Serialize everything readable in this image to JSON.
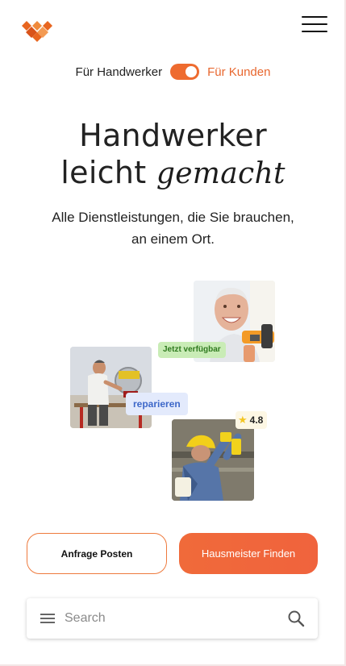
{
  "toggle": {
    "left_label": "Für Handwerker",
    "right_label": "Für Kunden",
    "active": "right"
  },
  "hero": {
    "title_line1": "Handwerker",
    "title_line2_plain": "leicht",
    "title_line2_script": "gemacht",
    "subtitle": "Alle Dienstleistungen, die Sie brauchen, an einem Ort."
  },
  "badges": {
    "available": "Jetzt verfügbar",
    "repair": "reparieren",
    "rating": "4.8"
  },
  "buttons": {
    "post_request": "Anfrage Posten",
    "find": "Hausmeister Finden"
  },
  "search": {
    "placeholder": "Search",
    "value": ""
  },
  "colors": {
    "accent": "#ee6b2f",
    "available_bg": "#c9ecb6",
    "repair_bg": "#e3eafc",
    "star": "#f3c623"
  },
  "icons": {
    "logo": "diamond-grid-logo",
    "menu": "hamburger-menu-icon",
    "search_menu": "hamburger-icon",
    "search": "magnifier-icon",
    "rating": "star-icon"
  }
}
